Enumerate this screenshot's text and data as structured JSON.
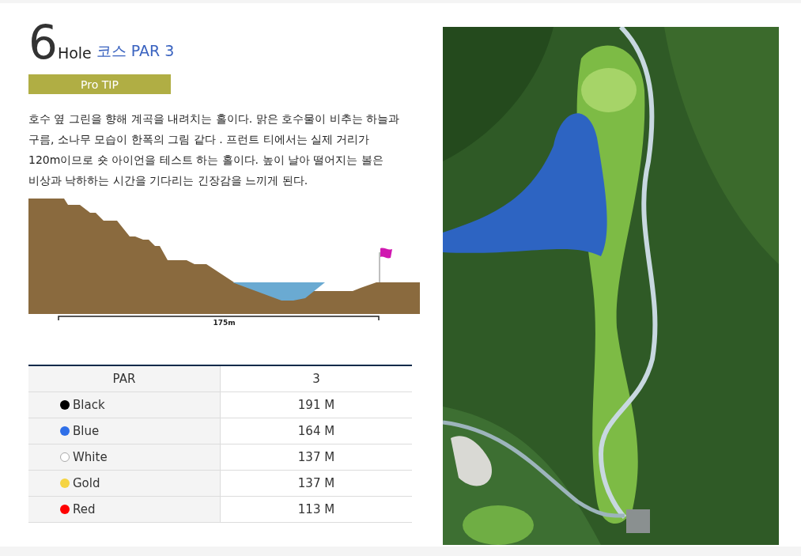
{
  "heading": {
    "number": "6",
    "label": "Hole",
    "course": "코스 PAR 3"
  },
  "tip_badge": "Pro TIP",
  "description": "호수 옆 그린을 향해 계곡을 내려치는 홀이다. 맑은 호수물이 비추는 하늘과 구름, 소나무 모습이 한폭의 그림 같다 . 프런트 티에서는 실제 거리가 120m이므로 숏 아이언을 테스트 하는 홀이다. 높이 날아 떨어지는 볼은 비상과 낙하하는 시간을 기다리는 긴장감을 느끼게 된다.",
  "profile": {
    "distance": "175m"
  },
  "table": {
    "header": [
      "PAR",
      "3"
    ],
    "rows": [
      {
        "tee": "Black",
        "color": "#000000",
        "distance": "191 M"
      },
      {
        "tee": "Blue",
        "color": "#2f6fe8",
        "distance": "164 M"
      },
      {
        "tee": "White",
        "color": "#ffffff",
        "distance": "137 M"
      },
      {
        "tee": "Gold",
        "color": "#f5d442",
        "distance": "137 M"
      },
      {
        "tee": "Red",
        "color": "#ff0000",
        "distance": "113 M"
      }
    ]
  }
}
